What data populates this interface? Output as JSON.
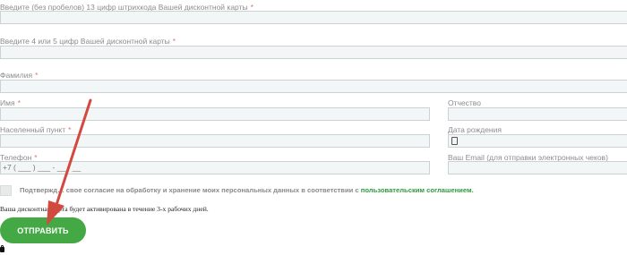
{
  "form": {
    "barcode_label": "Введите (без пробелов) 13 цифр штрихкода Вашей дисконтной карты",
    "card_digits_label": "Введите 4 или 5 цифр Вашей дисконтной карты",
    "surname_label": "Фамилия",
    "name_label": "Имя",
    "patronymic_label": "Отчество",
    "locality_label": "Населенный пункт",
    "birthdate_label": "Дата рождения",
    "phone_label": "Телефон",
    "phone_mask": "+7 ( ___ ) ___ - __ - __",
    "email_label": "Ваш Email (для отправки электронных чеков)",
    "required_mark": "*"
  },
  "consent": {
    "text_before": "Подтвержд… свое согласие на обработку и хранение моих персональных данных в соответствии с",
    "link": "пользовательским соглашением."
  },
  "notice": "Ваша дисконтная карта будет активирована в течение 3-х рабочих дней.",
  "submit_label": "ОТПРАВИТЬ",
  "colors": {
    "accent": "#44a944",
    "link": "#2e9a3c",
    "arrow": "#d2493f",
    "field_bg": "#f3f6f6"
  }
}
